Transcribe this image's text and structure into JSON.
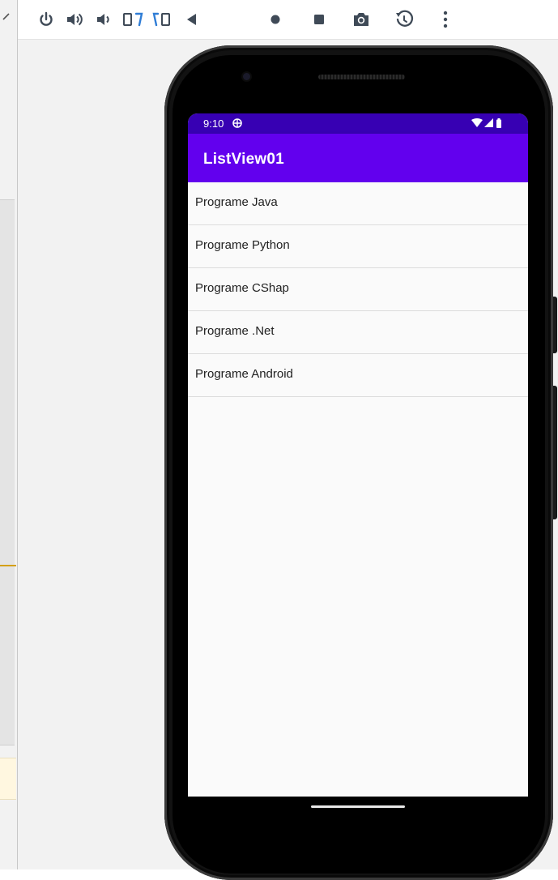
{
  "colors": {
    "status_bar": "#3700b3",
    "app_bar": "#6200ee",
    "toolbar_icon": "#3f4a57",
    "rotate_accent": "#2f7dd6",
    "left_marker": "#d4a017"
  },
  "toolbar": {
    "buttons": [
      {
        "icon": "power-icon"
      },
      {
        "icon": "volume-up-icon"
      },
      {
        "icon": "volume-down-icon"
      },
      {
        "icon": "rotate-left-icon"
      },
      {
        "icon": "rotate-right-icon"
      },
      {
        "icon": "back-icon"
      },
      {
        "icon": "home-icon"
      },
      {
        "icon": "overview-icon"
      },
      {
        "icon": "screenshot-icon"
      },
      {
        "icon": "snapshot-icon"
      },
      {
        "icon": "more-icon"
      }
    ]
  },
  "device": {
    "status_bar": {
      "time": "9:10",
      "icons": [
        "debug-icon",
        "wifi-icon",
        "signal-icon",
        "battery-icon"
      ]
    },
    "app_bar": {
      "title": "ListView01"
    },
    "list": {
      "items": [
        "Programe Java",
        "Programe Python",
        "Programe CShap",
        "Programe .Net",
        "Programe Android"
      ]
    }
  }
}
